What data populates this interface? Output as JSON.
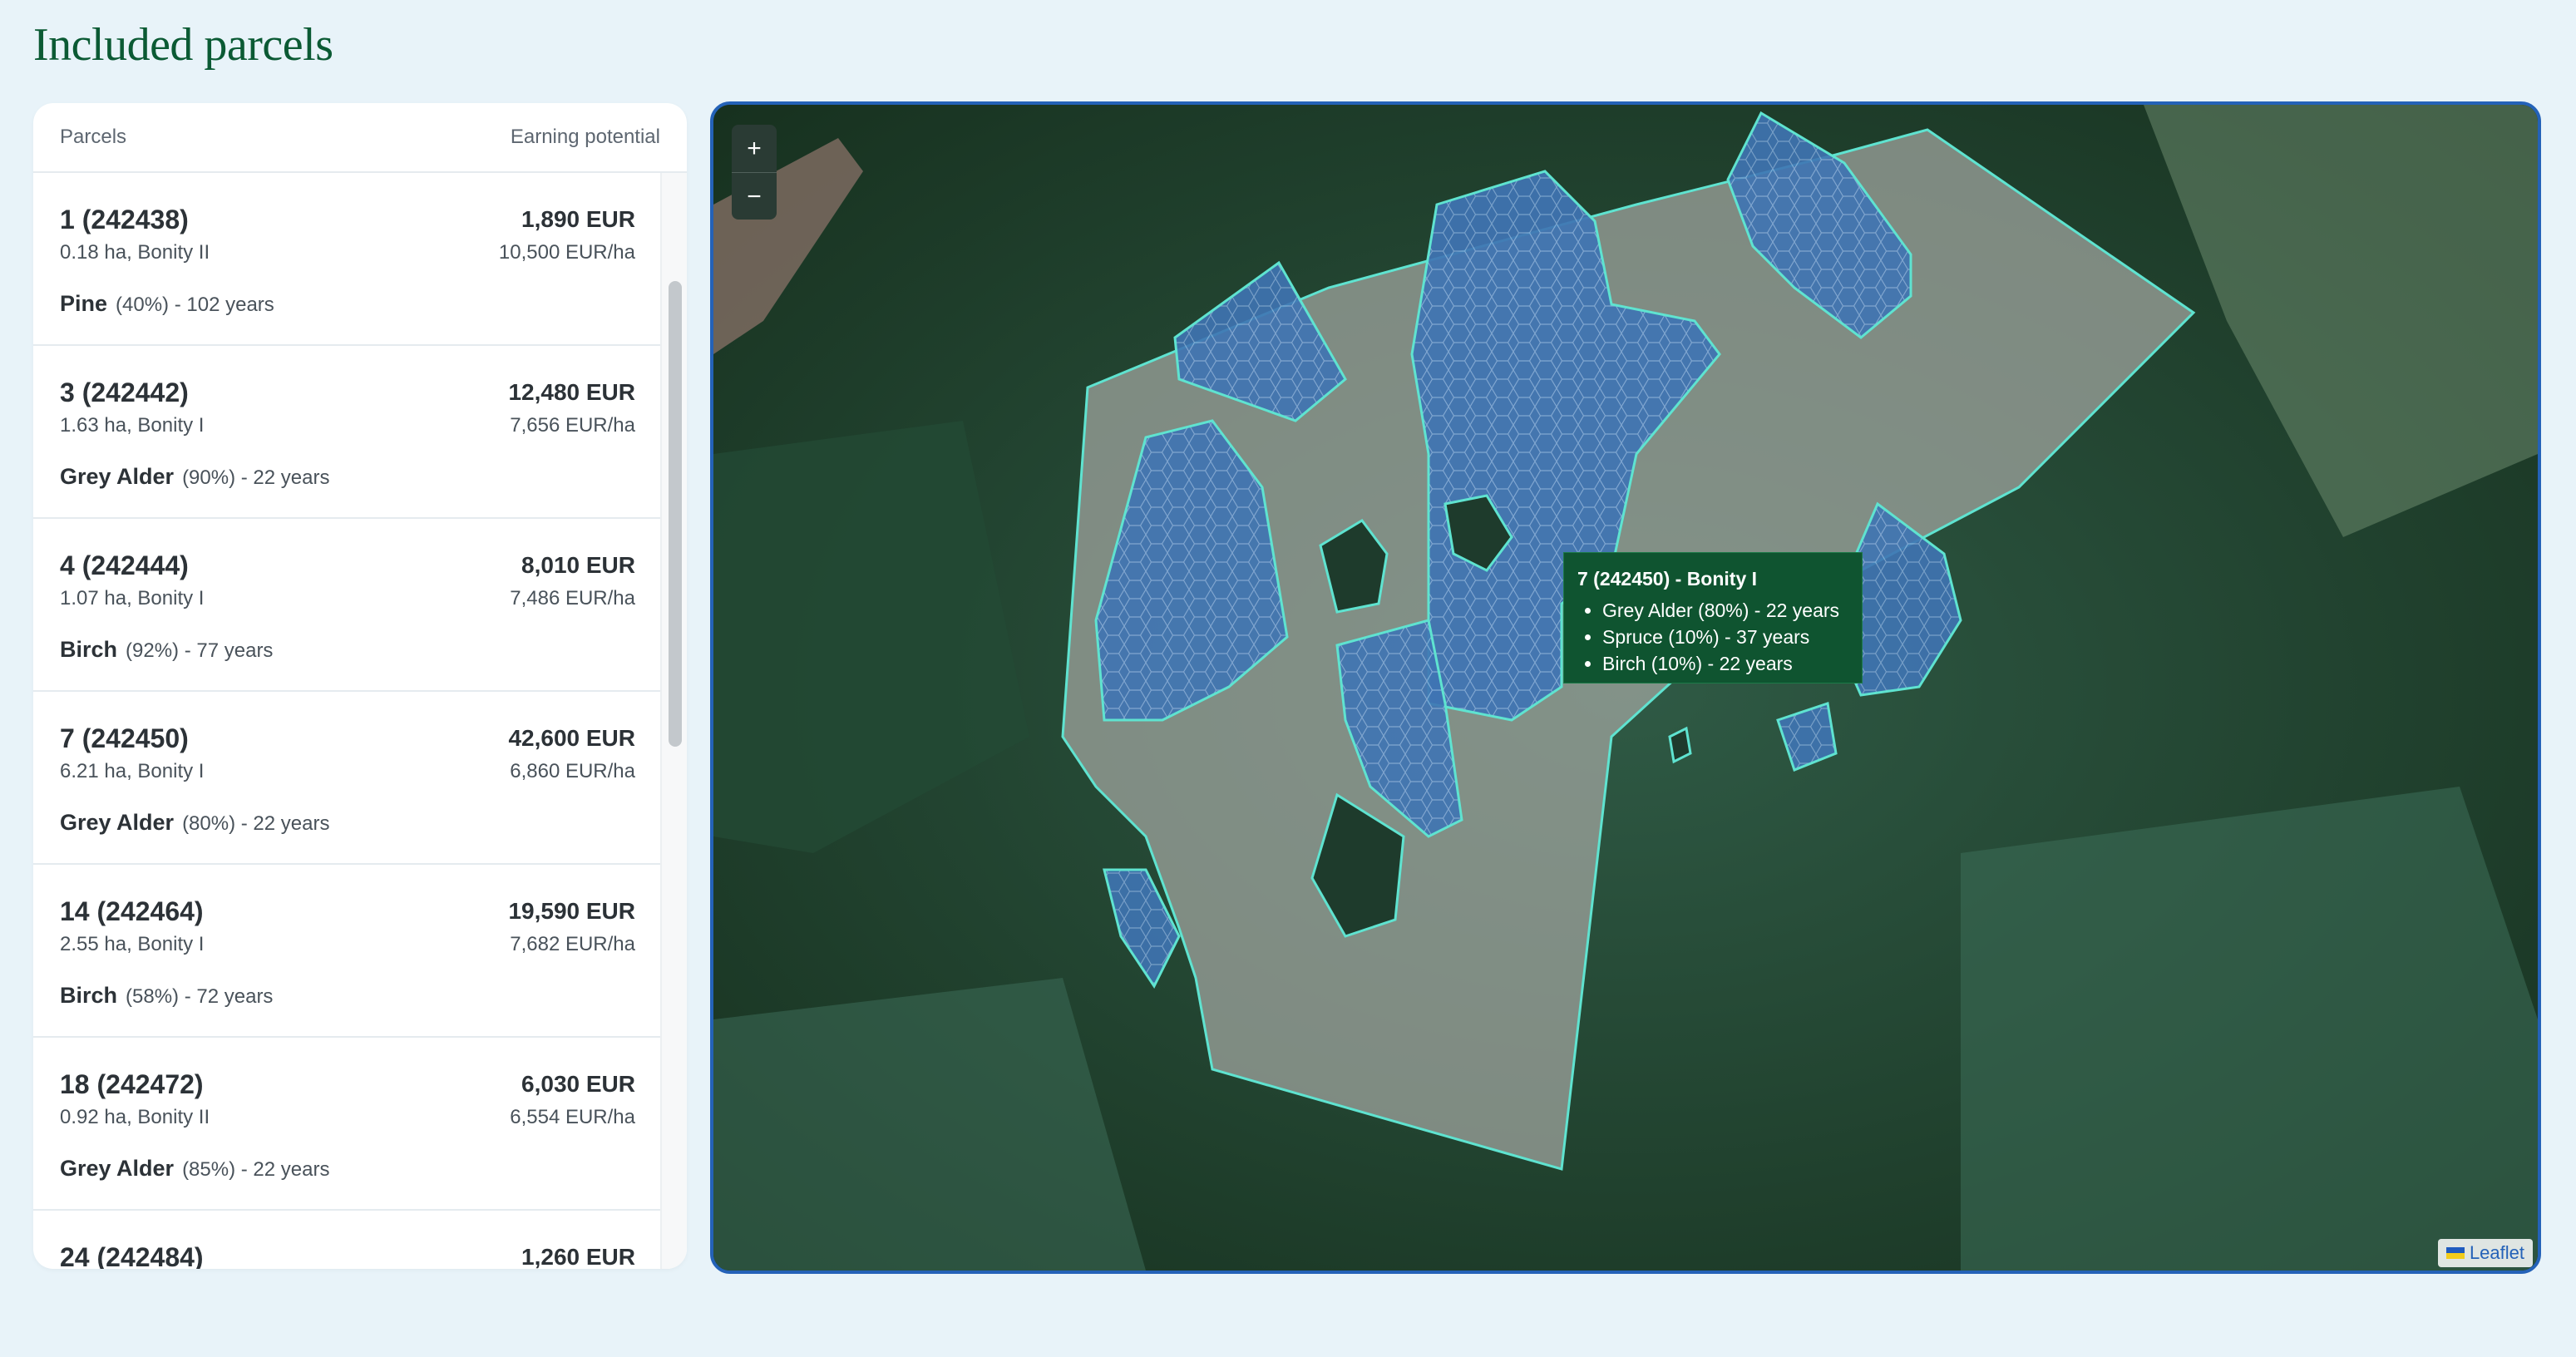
{
  "page": {
    "title": "Included parcels"
  },
  "panel": {
    "header_left": "Parcels",
    "header_right": "Earning potential",
    "parcels": [
      {
        "name": "1 (242438)",
        "meta": "0.18 ha, Bonity II",
        "species": "Pine",
        "detail": "(40%) - 102 years",
        "eur": "1,890 EUR",
        "eur_ha": "10,500 EUR/ha"
      },
      {
        "name": "3 (242442)",
        "meta": "1.63 ha, Bonity I",
        "species": "Grey Alder",
        "detail": "(90%) - 22 years",
        "eur": "12,480 EUR",
        "eur_ha": "7,656 EUR/ha"
      },
      {
        "name": "4 (242444)",
        "meta": "1.07 ha, Bonity I",
        "species": "Birch",
        "detail": "(92%) - 77 years",
        "eur": "8,010 EUR",
        "eur_ha": "7,486 EUR/ha"
      },
      {
        "name": "7 (242450)",
        "meta": "6.21 ha, Bonity I",
        "species": "Grey Alder",
        "detail": "(80%) - 22 years",
        "eur": "42,600 EUR",
        "eur_ha": "6,860 EUR/ha"
      },
      {
        "name": "14 (242464)",
        "meta": "2.55 ha, Bonity I",
        "species": "Birch",
        "detail": "(58%) - 72 years",
        "eur": "19,590 EUR",
        "eur_ha": "7,682 EUR/ha"
      },
      {
        "name": "18 (242472)",
        "meta": "0.92 ha, Bonity II",
        "species": "Grey Alder",
        "detail": "(85%) - 22 years",
        "eur": "6,030 EUR",
        "eur_ha": "6,554 EUR/ha"
      },
      {
        "name": "24 (242484)",
        "meta": "",
        "species": "",
        "detail": "",
        "eur": "1,260 EUR",
        "eur_ha": ""
      }
    ]
  },
  "map": {
    "zoom_in": "+",
    "zoom_out": "−",
    "tooltip": {
      "title": "7 (242450) - Bonity I",
      "items": [
        "Grey Alder (80%) - 22 years",
        "Spruce (10%) - 37 years",
        "Birch (10%) - 22 years"
      ]
    },
    "attribution": "Leaflet"
  },
  "colors": {
    "title": "#0b5a34",
    "map_border": "#2462b8",
    "parcel_outline": "#5fe3d0",
    "tooltip_bg": "#0f5430"
  }
}
